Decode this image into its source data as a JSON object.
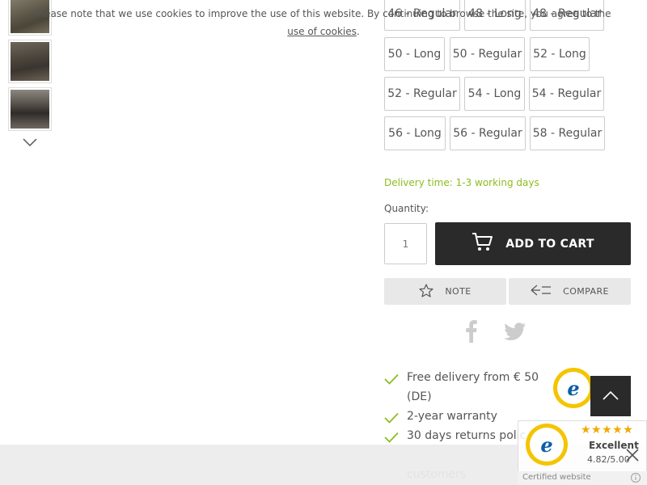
{
  "thumbnails": [
    "thumbnail-1",
    "thumbnail-2",
    "thumbnail-3"
  ],
  "sizes": [
    "46 - Regular",
    "48 - Long",
    "48 - Regular",
    "50 - Long",
    "50 - Regular",
    "52 - Long",
    "52 - Regular",
    "54 - Long",
    "54 - Regular",
    "56 - Long",
    "56 - Regular",
    "58 - Regular"
  ],
  "delivery_time": "Delivery time: 1-3 working days",
  "quantity": {
    "label": "Quantity:",
    "value": "1"
  },
  "actions": {
    "add_to_cart": "ADD TO CART",
    "note": "NOTE",
    "compare": "COMPARE"
  },
  "benefits": [
    "Free delivery from € 50",
    "(DE)",
    "2-year warranty",
    "30 days returns polic",
    "customers"
  ],
  "cookie": {
    "text": "Please note that we use cookies to improve the use of this website. By continuing to browse the site, you agree to the",
    "link": "use of cookies",
    "suffix": "."
  },
  "trusted_shops": {
    "stars": "★★★★★",
    "grade": "Excellent",
    "rating": "4.82/5.00",
    "certified": "Certified website"
  },
  "colors": {
    "accent_green": "#8bbd1f",
    "dark": "#2a2a2a",
    "star": "#f2a900",
    "seal_yellow": "#f5c400"
  }
}
